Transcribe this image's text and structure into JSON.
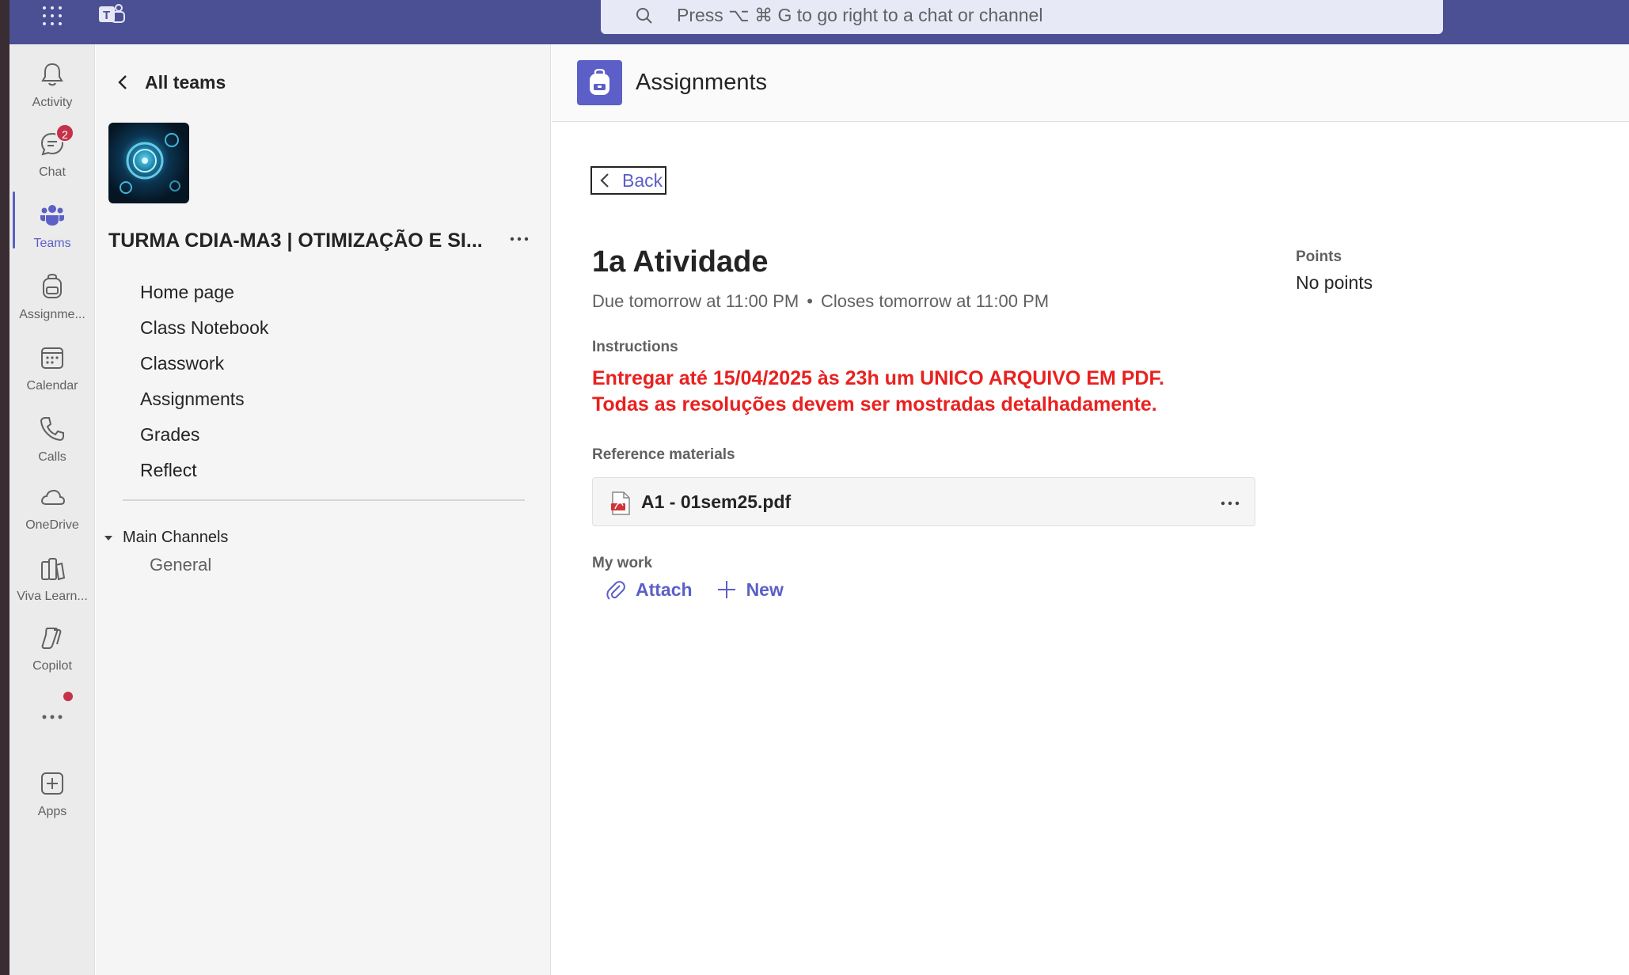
{
  "search": {
    "placeholder": "Press ⌥ ⌘ G to go right to a chat or channel"
  },
  "rail": {
    "items": [
      {
        "label": "Activity",
        "icon": "bell-icon"
      },
      {
        "label": "Chat",
        "icon": "chat-icon",
        "badge": "2"
      },
      {
        "label": "Teams",
        "icon": "teams-icon",
        "active": true
      },
      {
        "label": "Assignme...",
        "icon": "backpack-icon"
      },
      {
        "label": "Calendar",
        "icon": "calendar-icon"
      },
      {
        "label": "Calls",
        "icon": "phone-icon"
      },
      {
        "label": "OneDrive",
        "icon": "cloud-icon"
      },
      {
        "label": "Viva Learn...",
        "icon": "books-icon"
      },
      {
        "label": "Copilot",
        "icon": "copilot-icon"
      },
      {
        "label": "",
        "icon": "more-icon"
      },
      {
        "label": "Apps",
        "icon": "add-app-icon"
      }
    ]
  },
  "teamnav": {
    "back_label": "All teams",
    "team_name": "TURMA CDIA-MA3 | OTIMIZAÇÃO E SI...",
    "links": [
      "Home page",
      "Class Notebook",
      "Classwork",
      "Assignments",
      "Grades",
      "Reflect"
    ],
    "channels_header": "Main Channels",
    "channels": [
      "General"
    ]
  },
  "main": {
    "title": "Assignments",
    "back_label": "Back",
    "assignment": {
      "title": "1a Atividade",
      "due": "Due tomorrow at 11:00 PM",
      "separator": "•",
      "closes": "Closes tomorrow at 11:00 PM",
      "points_label": "Points",
      "points_value": "No points",
      "instructions_label": "Instructions",
      "instructions_line1": "Entregar até 15/04/2025 às 23h um UNICO ARQUIVO EM PDF.",
      "instructions_line2": "Todas as resoluções devem ser mostradas detalhadamente.",
      "reference_label": "Reference materials",
      "reference_file": "A1 - 01sem25.pdf",
      "my_work_label": "My work",
      "attach_label": "Attach",
      "new_label": "New"
    }
  },
  "colors": {
    "topbar": "#4b4f94",
    "accent": "#5b5fc7",
    "instructions": "#e8211f",
    "badge": "#c4314b"
  }
}
